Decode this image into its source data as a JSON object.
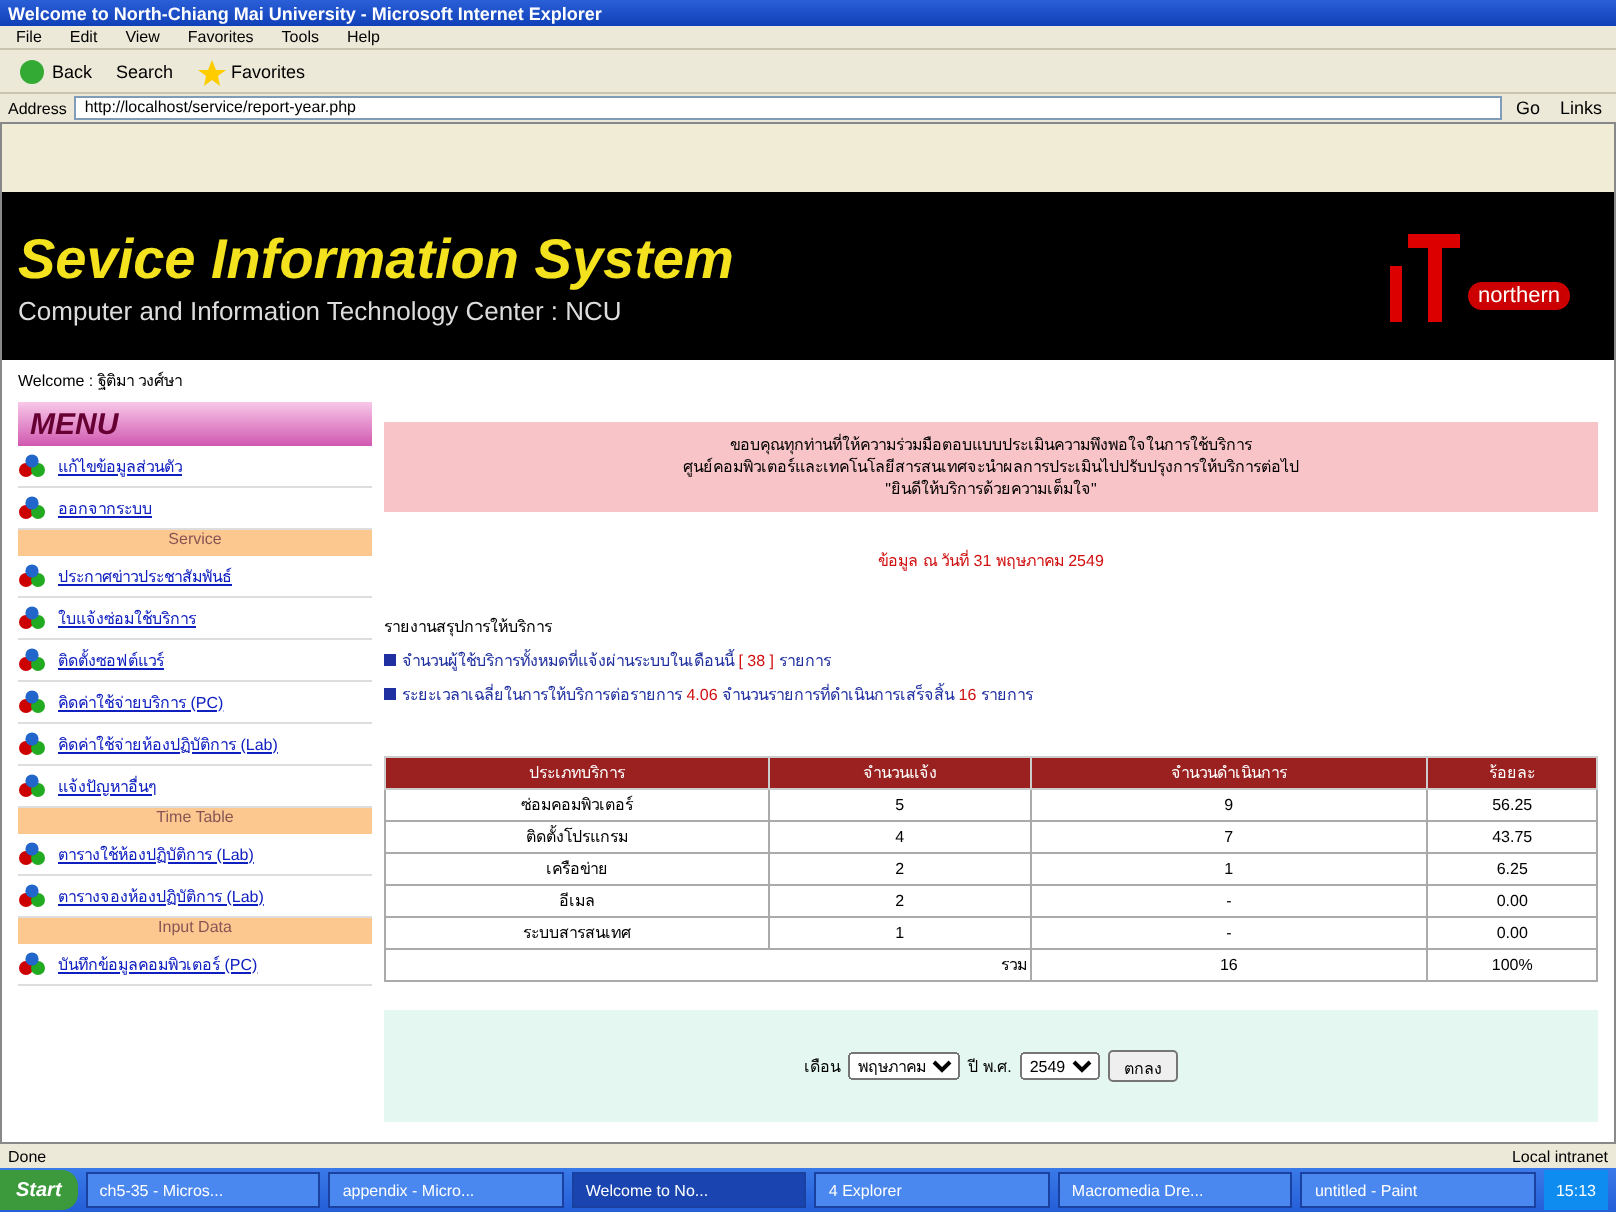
{
  "window": {
    "title": "Welcome to North-Chiang Mai University - Microsoft Internet Explorer"
  },
  "menu_bar": [
    "File",
    "Edit",
    "View",
    "Favorites",
    "Tools",
    "Help"
  ],
  "toolbar": {
    "back": "Back",
    "search": "Search",
    "favorites": "Favorites"
  },
  "address_bar": {
    "label": "Address",
    "url": "http://localhost/service/report-year.php",
    "go": "Go",
    "links": "Links"
  },
  "header": {
    "title": "Sevice Information System",
    "subtitle": "Computer and Information Technology Center : NCU",
    "logo_text": "northern"
  },
  "welcome": "Welcome : ฐิติมา วงศ์ษา",
  "sidebar": {
    "title": "MENU",
    "items": [
      {
        "kind": "link",
        "label": "แก้ไขข้อมูลส่วนตัว"
      },
      {
        "kind": "link",
        "label": "ออกจากระบบ"
      },
      {
        "kind": "section",
        "label": "Service"
      },
      {
        "kind": "link",
        "label": "ประกาศข่าวประชาสัมพันธ์"
      },
      {
        "kind": "link",
        "label": "ใบแจ้งซ่อมใช้บริการ"
      },
      {
        "kind": "link",
        "label": "ติดตั้งซอฟต์แวร์"
      },
      {
        "kind": "link",
        "label": "คิดค่าใช้จ่ายบริการ (PC)"
      },
      {
        "kind": "link",
        "label": "คิดค่าใช้จ่ายห้องปฏิบัติการ (Lab)"
      },
      {
        "kind": "link",
        "label": "แจ้งปัญหาอื่นๆ"
      },
      {
        "kind": "section",
        "label": "Time Table"
      },
      {
        "kind": "link",
        "label": "ตารางใช้ห้องปฏิบัติการ (Lab)"
      },
      {
        "kind": "link",
        "label": "ตารางจองห้องปฏิบัติการ (Lab)"
      },
      {
        "kind": "section",
        "label": "Input Data"
      },
      {
        "kind": "link",
        "label": "บันทึกข้อมูลคอมพิวเตอร์ (PC)"
      }
    ]
  },
  "notice": [
    "ขอบคุณทุกท่านที่ให้ความร่วมมือตอบแบบประเมินความพึงพอใจในการใช้บริการ",
    "ศูนย์คอมพิวเตอร์และเทคโนโลยีสารสนเทศจะนำผลการประเมินไปปรับปรุงการให้บริการต่อไป",
    "\"ยินดีให้บริการด้วยความเต็มใจ\""
  ],
  "report_date": "ข้อมูล ณ วันที่ 31 พฤษภาคม 2549",
  "summary": {
    "heading": "รายงานสรุปการให้บริการ",
    "lines": [
      {
        "text": "จำนวนผู้ใช้บริการทั้งหมดที่แจ้งผ่านระบบในเดือนนี้",
        "value": "[ 38 ]",
        "unit": "รายการ"
      },
      {
        "text": "ระยะเวลาเฉลี่ยในการให้บริการต่อรายการ",
        "value": "4.06",
        "text2": "จำนวนรายการที่ดำเนินการเสร็จสิ้น",
        "value2": "16",
        "unit": "รายการ"
      }
    ]
  },
  "table": {
    "columns": [
      "ประเภทบริการ",
      "จำนวนแจ้ง",
      "จำนวนดำเนินการ",
      "ร้อยละ"
    ],
    "rows": [
      [
        "ซ่อมคอมพิวเตอร์",
        "5",
        "9",
        "56.25"
      ],
      [
        "ติดตั้งโปรแกรม",
        "4",
        "7",
        "43.75"
      ],
      [
        "เครือข่าย",
        "2",
        "1",
        "6.25"
      ],
      [
        "อีเมล",
        "2",
        "-",
        "0.00"
      ],
      [
        "ระบบสารสนเทศ",
        "1",
        "-",
        "0.00"
      ]
    ],
    "total": {
      "label": "รวม",
      "value": "16",
      "percent": "100%"
    }
  },
  "filter": {
    "month_label": "เดือน",
    "month": "พฤษภาคม",
    "year_label": "ปี พ.ศ.",
    "year": "2549",
    "button": "ตกลง"
  },
  "status_bar": {
    "text": "Done",
    "zone": "Local intranet"
  },
  "taskbar": {
    "start": "Start",
    "tasks": [
      {
        "label": "ch5-35 - Micros...",
        "selected": false
      },
      {
        "label": "appendix - Micro...",
        "selected": false
      },
      {
        "label": "Welcome to No...",
        "selected": true
      },
      {
        "label": "4 Explorer",
        "selected": false
      },
      {
        "label": "Macromedia Dre...",
        "selected": false
      },
      {
        "label": "untitled - Paint",
        "selected": false
      }
    ],
    "clock": "15:13"
  }
}
